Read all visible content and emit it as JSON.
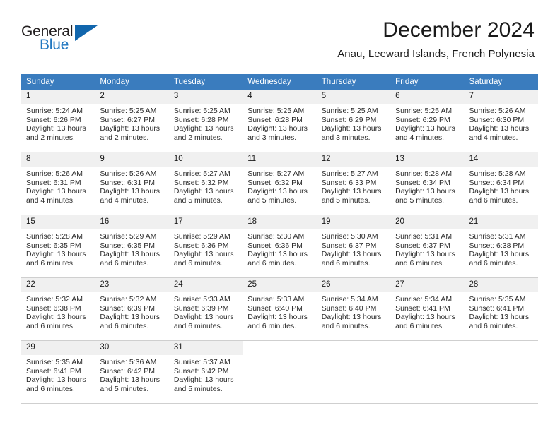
{
  "brand": {
    "name_part1": "General",
    "name_part2": "Blue",
    "logo_icon": "triangle-logo-icon",
    "accent_color": "#1166ad"
  },
  "header": {
    "title": "December 2024",
    "location": "Anau, Leeward Islands, French Polynesia"
  },
  "calendar": {
    "header_bg": "#3a7cbe",
    "daynum_bg": "#f0f0f0",
    "weekdays": [
      "Sunday",
      "Monday",
      "Tuesday",
      "Wednesday",
      "Thursday",
      "Friday",
      "Saturday"
    ],
    "weeks": [
      [
        {
          "day": "1",
          "sunrise": "Sunrise: 5:24 AM",
          "sunset": "Sunset: 6:26 PM",
          "daylight1": "Daylight: 13 hours",
          "daylight2": "and 2 minutes."
        },
        {
          "day": "2",
          "sunrise": "Sunrise: 5:25 AM",
          "sunset": "Sunset: 6:27 PM",
          "daylight1": "Daylight: 13 hours",
          "daylight2": "and 2 minutes."
        },
        {
          "day": "3",
          "sunrise": "Sunrise: 5:25 AM",
          "sunset": "Sunset: 6:28 PM",
          "daylight1": "Daylight: 13 hours",
          "daylight2": "and 2 minutes."
        },
        {
          "day": "4",
          "sunrise": "Sunrise: 5:25 AM",
          "sunset": "Sunset: 6:28 PM",
          "daylight1": "Daylight: 13 hours",
          "daylight2": "and 3 minutes."
        },
        {
          "day": "5",
          "sunrise": "Sunrise: 5:25 AM",
          "sunset": "Sunset: 6:29 PM",
          "daylight1": "Daylight: 13 hours",
          "daylight2": "and 3 minutes."
        },
        {
          "day": "6",
          "sunrise": "Sunrise: 5:25 AM",
          "sunset": "Sunset: 6:29 PM",
          "daylight1": "Daylight: 13 hours",
          "daylight2": "and 4 minutes."
        },
        {
          "day": "7",
          "sunrise": "Sunrise: 5:26 AM",
          "sunset": "Sunset: 6:30 PM",
          "daylight1": "Daylight: 13 hours",
          "daylight2": "and 4 minutes."
        }
      ],
      [
        {
          "day": "8",
          "sunrise": "Sunrise: 5:26 AM",
          "sunset": "Sunset: 6:31 PM",
          "daylight1": "Daylight: 13 hours",
          "daylight2": "and 4 minutes."
        },
        {
          "day": "9",
          "sunrise": "Sunrise: 5:26 AM",
          "sunset": "Sunset: 6:31 PM",
          "daylight1": "Daylight: 13 hours",
          "daylight2": "and 4 minutes."
        },
        {
          "day": "10",
          "sunrise": "Sunrise: 5:27 AM",
          "sunset": "Sunset: 6:32 PM",
          "daylight1": "Daylight: 13 hours",
          "daylight2": "and 5 minutes."
        },
        {
          "day": "11",
          "sunrise": "Sunrise: 5:27 AM",
          "sunset": "Sunset: 6:32 PM",
          "daylight1": "Daylight: 13 hours",
          "daylight2": "and 5 minutes."
        },
        {
          "day": "12",
          "sunrise": "Sunrise: 5:27 AM",
          "sunset": "Sunset: 6:33 PM",
          "daylight1": "Daylight: 13 hours",
          "daylight2": "and 5 minutes."
        },
        {
          "day": "13",
          "sunrise": "Sunrise: 5:28 AM",
          "sunset": "Sunset: 6:34 PM",
          "daylight1": "Daylight: 13 hours",
          "daylight2": "and 5 minutes."
        },
        {
          "day": "14",
          "sunrise": "Sunrise: 5:28 AM",
          "sunset": "Sunset: 6:34 PM",
          "daylight1": "Daylight: 13 hours",
          "daylight2": "and 6 minutes."
        }
      ],
      [
        {
          "day": "15",
          "sunrise": "Sunrise: 5:28 AM",
          "sunset": "Sunset: 6:35 PM",
          "daylight1": "Daylight: 13 hours",
          "daylight2": "and 6 minutes."
        },
        {
          "day": "16",
          "sunrise": "Sunrise: 5:29 AM",
          "sunset": "Sunset: 6:35 PM",
          "daylight1": "Daylight: 13 hours",
          "daylight2": "and 6 minutes."
        },
        {
          "day": "17",
          "sunrise": "Sunrise: 5:29 AM",
          "sunset": "Sunset: 6:36 PM",
          "daylight1": "Daylight: 13 hours",
          "daylight2": "and 6 minutes."
        },
        {
          "day": "18",
          "sunrise": "Sunrise: 5:30 AM",
          "sunset": "Sunset: 6:36 PM",
          "daylight1": "Daylight: 13 hours",
          "daylight2": "and 6 minutes."
        },
        {
          "day": "19",
          "sunrise": "Sunrise: 5:30 AM",
          "sunset": "Sunset: 6:37 PM",
          "daylight1": "Daylight: 13 hours",
          "daylight2": "and 6 minutes."
        },
        {
          "day": "20",
          "sunrise": "Sunrise: 5:31 AM",
          "sunset": "Sunset: 6:37 PM",
          "daylight1": "Daylight: 13 hours",
          "daylight2": "and 6 minutes."
        },
        {
          "day": "21",
          "sunrise": "Sunrise: 5:31 AM",
          "sunset": "Sunset: 6:38 PM",
          "daylight1": "Daylight: 13 hours",
          "daylight2": "and 6 minutes."
        }
      ],
      [
        {
          "day": "22",
          "sunrise": "Sunrise: 5:32 AM",
          "sunset": "Sunset: 6:38 PM",
          "daylight1": "Daylight: 13 hours",
          "daylight2": "and 6 minutes."
        },
        {
          "day": "23",
          "sunrise": "Sunrise: 5:32 AM",
          "sunset": "Sunset: 6:39 PM",
          "daylight1": "Daylight: 13 hours",
          "daylight2": "and 6 minutes."
        },
        {
          "day": "24",
          "sunrise": "Sunrise: 5:33 AM",
          "sunset": "Sunset: 6:39 PM",
          "daylight1": "Daylight: 13 hours",
          "daylight2": "and 6 minutes."
        },
        {
          "day": "25",
          "sunrise": "Sunrise: 5:33 AM",
          "sunset": "Sunset: 6:40 PM",
          "daylight1": "Daylight: 13 hours",
          "daylight2": "and 6 minutes."
        },
        {
          "day": "26",
          "sunrise": "Sunrise: 5:34 AM",
          "sunset": "Sunset: 6:40 PM",
          "daylight1": "Daylight: 13 hours",
          "daylight2": "and 6 minutes."
        },
        {
          "day": "27",
          "sunrise": "Sunrise: 5:34 AM",
          "sunset": "Sunset: 6:41 PM",
          "daylight1": "Daylight: 13 hours",
          "daylight2": "and 6 minutes."
        },
        {
          "day": "28",
          "sunrise": "Sunrise: 5:35 AM",
          "sunset": "Sunset: 6:41 PM",
          "daylight1": "Daylight: 13 hours",
          "daylight2": "and 6 minutes."
        }
      ],
      [
        {
          "day": "29",
          "sunrise": "Sunrise: 5:35 AM",
          "sunset": "Sunset: 6:41 PM",
          "daylight1": "Daylight: 13 hours",
          "daylight2": "and 6 minutes."
        },
        {
          "day": "30",
          "sunrise": "Sunrise: 5:36 AM",
          "sunset": "Sunset: 6:42 PM",
          "daylight1": "Daylight: 13 hours",
          "daylight2": "and 5 minutes."
        },
        {
          "day": "31",
          "sunrise": "Sunrise: 5:37 AM",
          "sunset": "Sunset: 6:42 PM",
          "daylight1": "Daylight: 13 hours",
          "daylight2": "and 5 minutes."
        },
        {
          "day": "",
          "sunrise": "",
          "sunset": "",
          "daylight1": "",
          "daylight2": ""
        },
        {
          "day": "",
          "sunrise": "",
          "sunset": "",
          "daylight1": "",
          "daylight2": ""
        },
        {
          "day": "",
          "sunrise": "",
          "sunset": "",
          "daylight1": "",
          "daylight2": ""
        },
        {
          "day": "",
          "sunrise": "",
          "sunset": "",
          "daylight1": "",
          "daylight2": ""
        }
      ]
    ]
  }
}
